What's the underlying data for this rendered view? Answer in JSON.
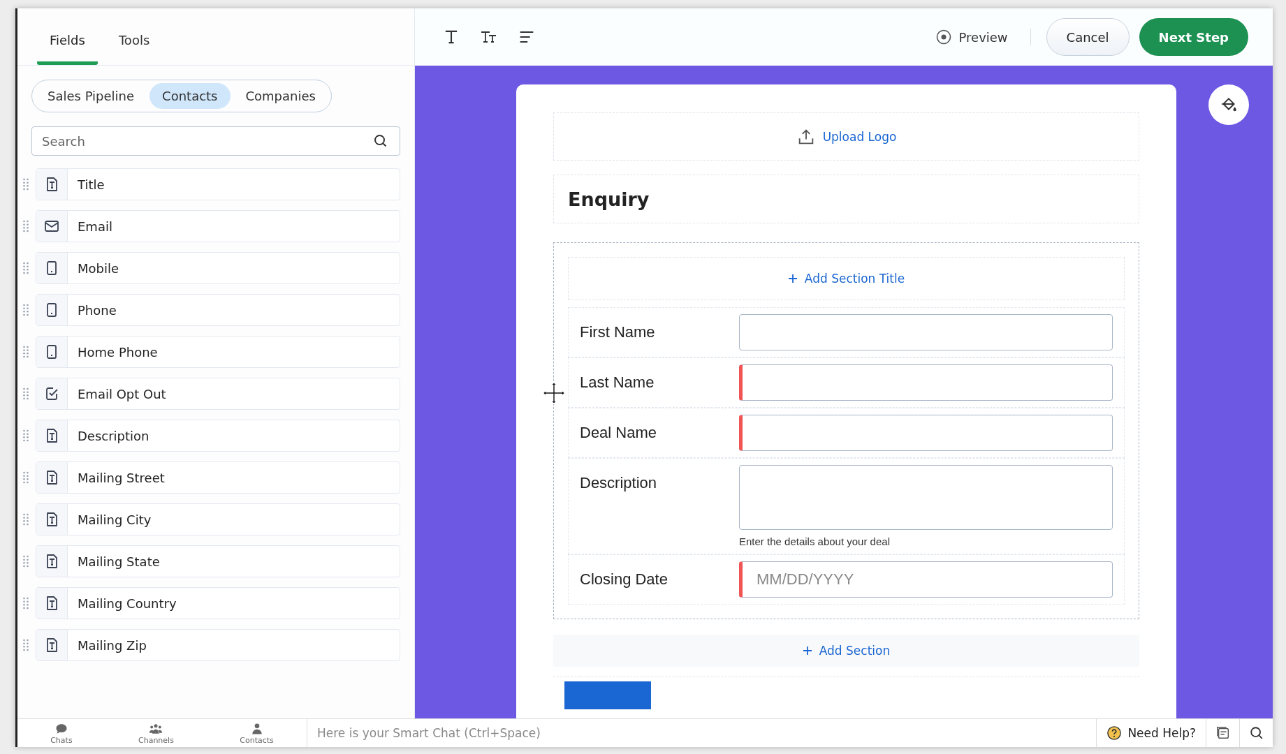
{
  "left_tabs": [
    {
      "label": "Fields",
      "selected": true
    },
    {
      "label": "Tools",
      "selected": false
    }
  ],
  "modules": [
    {
      "label": "Sales Pipeline",
      "selected": false
    },
    {
      "label": "Contacts",
      "selected": true
    },
    {
      "label": "Companies",
      "selected": false
    }
  ],
  "search": {
    "placeholder": "Search"
  },
  "fields": [
    {
      "label": "Title",
      "kind": "text"
    },
    {
      "label": "Email",
      "kind": "email"
    },
    {
      "label": "Mobile",
      "kind": "phone"
    },
    {
      "label": "Phone",
      "kind": "phone"
    },
    {
      "label": "Home Phone",
      "kind": "phone"
    },
    {
      "label": "Email Opt Out",
      "kind": "checkbox"
    },
    {
      "label": "Description",
      "kind": "text"
    },
    {
      "label": "Mailing Street",
      "kind": "text"
    },
    {
      "label": "Mailing City",
      "kind": "text"
    },
    {
      "label": "Mailing State",
      "kind": "text"
    },
    {
      "label": "Mailing Country",
      "kind": "text"
    },
    {
      "label": "Mailing Zip",
      "kind": "text"
    }
  ],
  "toolbar": {
    "preview": "Preview",
    "cancel": "Cancel",
    "next": "Next Step"
  },
  "form": {
    "upload_logo": "Upload Logo",
    "title": "Enquiry",
    "add_section_title": "Add Section Title",
    "rows": [
      {
        "label": "First Name",
        "kind": "input",
        "required": false
      },
      {
        "label": "Last Name",
        "kind": "input",
        "required": true
      },
      {
        "label": "Deal Name",
        "kind": "input",
        "required": true
      },
      {
        "label": "Description",
        "kind": "textarea",
        "required": false,
        "help": "Enter the details about your deal"
      },
      {
        "label": "Closing Date",
        "kind": "input",
        "required": true,
        "placeholder": "MM/DD/YYYY"
      }
    ],
    "add_section": "Add Section"
  },
  "bottom_bar": {
    "apps": [
      {
        "label": "Chats",
        "kind": "chat"
      },
      {
        "label": "Channels",
        "kind": "channels"
      },
      {
        "label": "Contacts",
        "kind": "contact"
      }
    ],
    "chat_placeholder": "Here is your Smart Chat (Ctrl+Space)",
    "help": "Need Help?"
  }
}
